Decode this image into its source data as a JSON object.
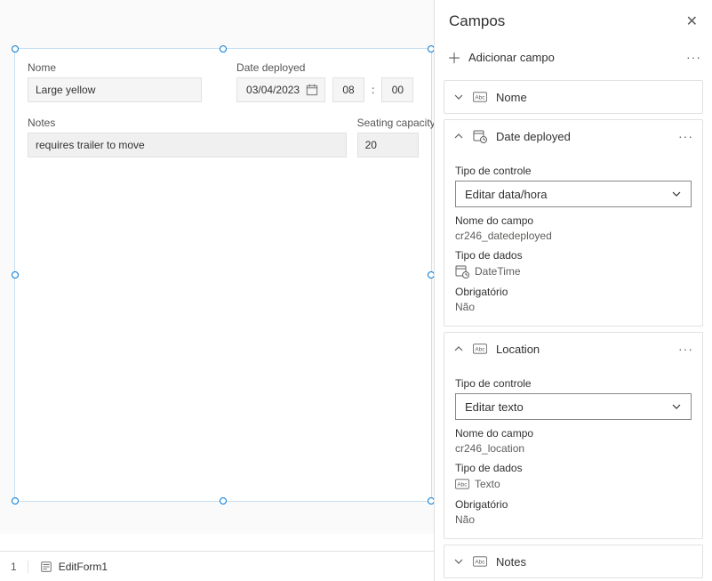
{
  "form": {
    "name_label": "Nome",
    "name_value": "Large yellow",
    "date_label": "Date deployed",
    "date_value": "03/04/2023",
    "time_hour": "08",
    "time_minute": "00",
    "notes_label": "Notes",
    "notes_value": "requires trailer to move",
    "seating_label": "Seating capacity",
    "seating_value": "20"
  },
  "bottom_bar": {
    "pre": "1",
    "item_name": "EditForm1"
  },
  "panel": {
    "title": "Campos",
    "add_label": "Adicionar campo",
    "cards": [
      {
        "title": "Nome",
        "type": "text",
        "expanded": false
      },
      {
        "title": "Date deployed",
        "type": "datetime",
        "expanded": true,
        "control_type_label": "Tipo de controle",
        "control_type_value": "Editar data/hora",
        "fieldname_label": "Nome do campo",
        "fieldname_value": "cr246_datedeployed",
        "datatype_label": "Tipo de dados",
        "datatype_value": "DateTime",
        "required_label": "Obrigatório",
        "required_value": "Não"
      },
      {
        "title": "Location",
        "type": "text",
        "expanded": true,
        "control_type_label": "Tipo de controle",
        "control_type_value": "Editar texto",
        "fieldname_label": "Nome do campo",
        "fieldname_value": "cr246_location",
        "datatype_label": "Tipo de dados",
        "datatype_value": "Texto",
        "required_label": "Obrigatório",
        "required_value": "Não"
      },
      {
        "title": "Notes",
        "type": "text",
        "expanded": false
      }
    ]
  }
}
